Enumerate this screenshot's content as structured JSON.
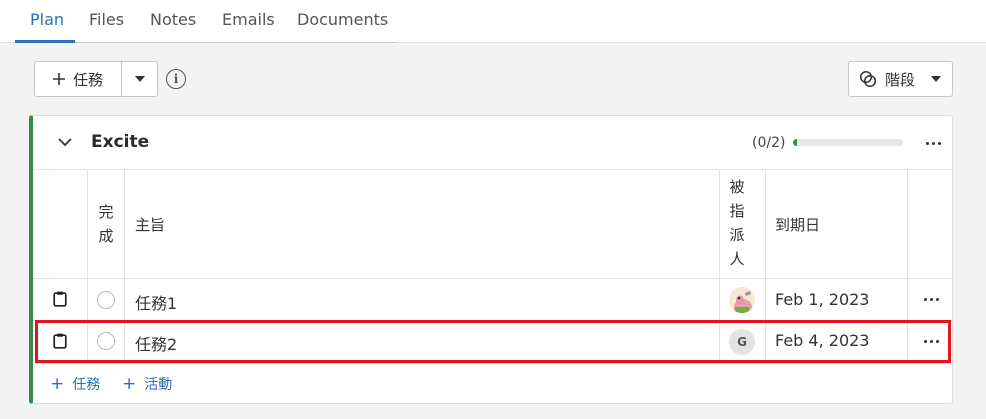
{
  "tabs": [
    {
      "label": "Plan",
      "active": true
    },
    {
      "label": "Files",
      "active": false
    },
    {
      "label": "Notes",
      "active": false
    },
    {
      "label": "Emails",
      "active": false
    },
    {
      "label": "Documents",
      "active": false
    }
  ],
  "toolbar": {
    "add_task_label": "任務",
    "stage_label": "階段"
  },
  "card": {
    "title": "Excite",
    "progress_text": "(0/2)",
    "progress_fraction": 0.04,
    "accent_color": "#3a8a48"
  },
  "table": {
    "headers": {
      "done": [
        "完",
        "成"
      ],
      "subject": "主旨",
      "assignee": [
        "被",
        "指",
        "派",
        "人"
      ],
      "due_date": "到期日"
    },
    "rows": [
      {
        "subject": "任務1",
        "assignee_type": "image",
        "due_date": "Feb 1, 2023"
      },
      {
        "subject": "任務2",
        "assignee_initial": "G",
        "due_date": "Feb 4, 2023"
      }
    ]
  },
  "footer": {
    "add_task_label": "任務",
    "add_activity_label": "活動"
  },
  "colors": {
    "link": "#2a6fb7",
    "highlight": "#e0151f"
  }
}
